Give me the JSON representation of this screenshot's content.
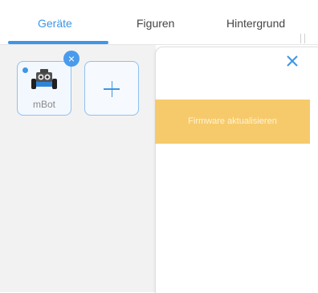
{
  "tabs": [
    {
      "label": "Geräte",
      "active": true
    },
    {
      "label": "Figuren",
      "active": false
    },
    {
      "label": "Hintergrund",
      "active": false
    }
  ],
  "devices": [
    {
      "label": "mBot",
      "connected": true,
      "icon": "mbot-robot-icon"
    }
  ],
  "dialog": {
    "close_icon": "close-icon",
    "firmware_button": "Firmware aktualisieren"
  },
  "colors": {
    "accent": "#3d96e6",
    "firmware_button_bg": "#f6ca6b",
    "panel_bg": "#f2f2f2"
  }
}
